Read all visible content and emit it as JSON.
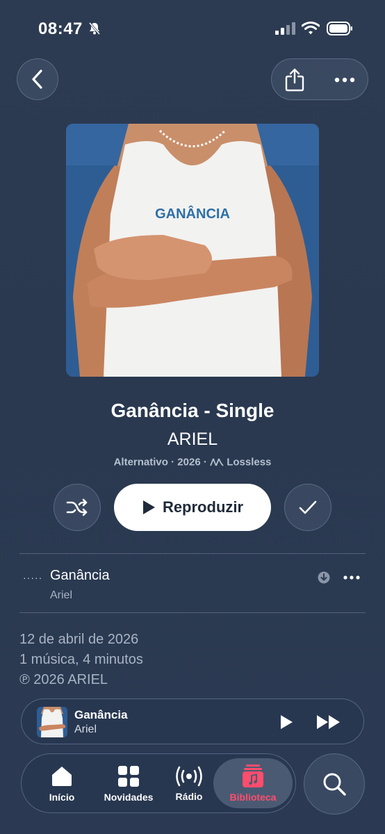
{
  "status_bar": {
    "time": "08:47",
    "icons": [
      "bell-slash-icon",
      "cellular-signal-icon",
      "wifi-icon",
      "battery-icon"
    ]
  },
  "nav": {
    "back_icon": "chevron-left-icon",
    "share_icon": "share-icon",
    "more_icon": "ellipsis-icon"
  },
  "album": {
    "artwork_text": "GANÂNCIA",
    "title": "Ganância - Single",
    "artist": "ARIEL",
    "genre": "Alternativo",
    "year": "2026",
    "quality": "Lossless"
  },
  "actions": {
    "shuffle_icon": "shuffle-icon",
    "play_label": "Reproduzir",
    "added_icon": "checkmark-icon"
  },
  "tracks": [
    {
      "number": "·····",
      "title": "Ganância",
      "artist": "Ariel"
    }
  ],
  "release": {
    "date": "12 de abril de 2026",
    "summary": "1 música, 4 minutos",
    "copyright": "℗ 2026 ARIEL"
  },
  "mini_player": {
    "title": "Ganância",
    "artist": "Ariel"
  },
  "tabs": [
    {
      "label": "Início",
      "icon": "home-icon"
    },
    {
      "label": "Novidades",
      "icon": "grid-icon"
    },
    {
      "label": "Rádio",
      "icon": "radio-icon"
    },
    {
      "label": "Biblioteca",
      "icon": "library-icon",
      "active": true
    }
  ],
  "colors": {
    "background": "#2b3a52",
    "accent": "#ff4d6d",
    "secondary_text": "#a9b4c4"
  }
}
